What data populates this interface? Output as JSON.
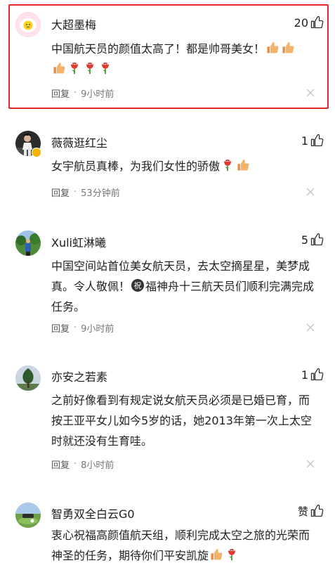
{
  "comments": [
    {
      "name": "大超墨梅",
      "likes": "20",
      "text": "中国航天员的颜值太高了！都是帅哥美女！",
      "reply_label": "回复",
      "time": "9小时前",
      "avatar_icon": "egg-face-icon"
    },
    {
      "name": "薇薇逛红尘",
      "likes": "1",
      "text": "女宇航员真棒，为我们女性的骄傲",
      "reply_label": "回复",
      "time": "53分钟前",
      "avatar_icon": "person-photo-icon"
    },
    {
      "name": "Xuli虹淋曦",
      "likes": "5",
      "text_part1": "中国空间站首位美女航天员，去太空摘星星，美梦成真。令人敬佩！",
      "text_part2": "福神舟十三航天员们顺利完满完成任务。",
      "reply_label": "回复",
      "time": "9小时前",
      "avatar_icon": "outdoor-photo-icon"
    },
    {
      "name": "亦安之若素",
      "likes": "1",
      "text": "之前好像看到有规定说女航天员必须是已婚已育，而按王亚平女儿如今5岁的话，她2013年第一次上太空时就还没有生育哇。",
      "reply_label": "回复",
      "time": "8小时前",
      "avatar_icon": "tree-photo-icon"
    },
    {
      "name": "智勇双全白云G0",
      "likes": "赞",
      "text": "衷心祝福高颜值航天组，顺利完成太空之旅的光荣而神圣的任务，期待你们平安凯旋",
      "avatar_icon": "golf-photo-icon"
    }
  ],
  "colors": {
    "highlight": "#e0282e",
    "meta": "#777777",
    "divider": "#f3f3f3"
  }
}
